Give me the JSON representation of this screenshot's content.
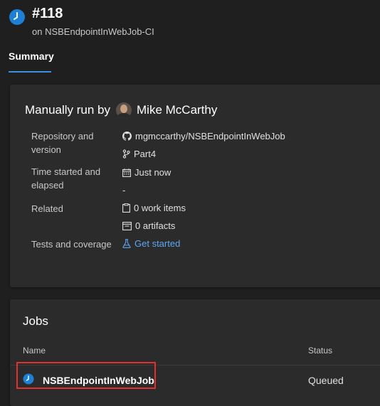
{
  "run": {
    "number": "#118",
    "pipeline": "on NSBEndpointInWebJob-CI"
  },
  "tabs": [
    {
      "label": "Summary",
      "selected": true
    }
  ],
  "summary": {
    "run_by_prefix": "Manually run by",
    "run_by_name": "Mike McCarthy",
    "repository_label": "Repository and version",
    "repository": "mgmccarthy/NSBEndpointInWebJob",
    "branch": "Part4",
    "time_label": "Time started and elapsed",
    "started": "Just now",
    "elapsed": "-",
    "related_label": "Related",
    "work_items": "0 work items",
    "artifacts": "0 artifacts",
    "tests_label": "Tests and coverage",
    "tests_link": "Get started"
  },
  "jobs": {
    "title": "Jobs",
    "columns": {
      "name": "Name",
      "status": "Status"
    },
    "rows": [
      {
        "name": "NSBEndpointInWebJob",
        "status": "Queued"
      }
    ]
  },
  "colors": {
    "accent": "#3b8ee0",
    "link": "#5ea8f0",
    "highlight": "#e03030",
    "queued_icon": "#1e7fd6"
  },
  "icons": [
    "queued-clock-icon",
    "github-icon",
    "branch-icon",
    "calendar-icon",
    "clipboard-icon",
    "artifact-icon",
    "flask-icon"
  ]
}
